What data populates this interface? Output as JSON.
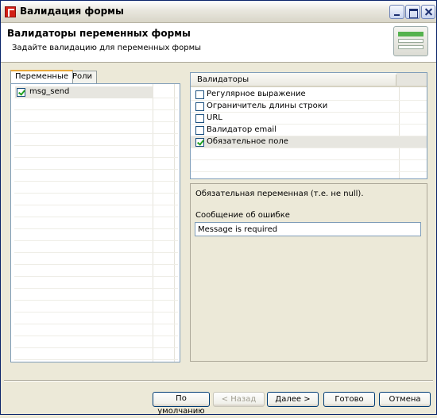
{
  "window": {
    "title": "Валидация формы"
  },
  "header": {
    "title": "Валидаторы переменных формы",
    "subtitle": "Задайте валидацию для переменных формы"
  },
  "tabs": [
    {
      "label": "Переменные",
      "active": true
    },
    {
      "label": "Роли",
      "active": false
    }
  ],
  "variables": [
    {
      "name": "msg_send",
      "checked": true
    }
  ],
  "validators": {
    "header": "Валидаторы",
    "items": [
      {
        "label": "Регулярное выражение",
        "checked": false
      },
      {
        "label": "Ограничитель длины строки",
        "checked": false
      },
      {
        "label": "URL",
        "checked": false
      },
      {
        "label": "Валидатор email",
        "checked": false
      },
      {
        "label": "Обязательное поле",
        "checked": true
      }
    ]
  },
  "details": {
    "description": "Обязательная переменная (т.е. не null).",
    "error_label": "Сообщение об ошибке",
    "error_value": "Message is required"
  },
  "buttons": {
    "defaults": "По умолчанию",
    "back": "< Назад",
    "next": "Далее >",
    "finish": "Готово",
    "cancel": "Отмена"
  }
}
